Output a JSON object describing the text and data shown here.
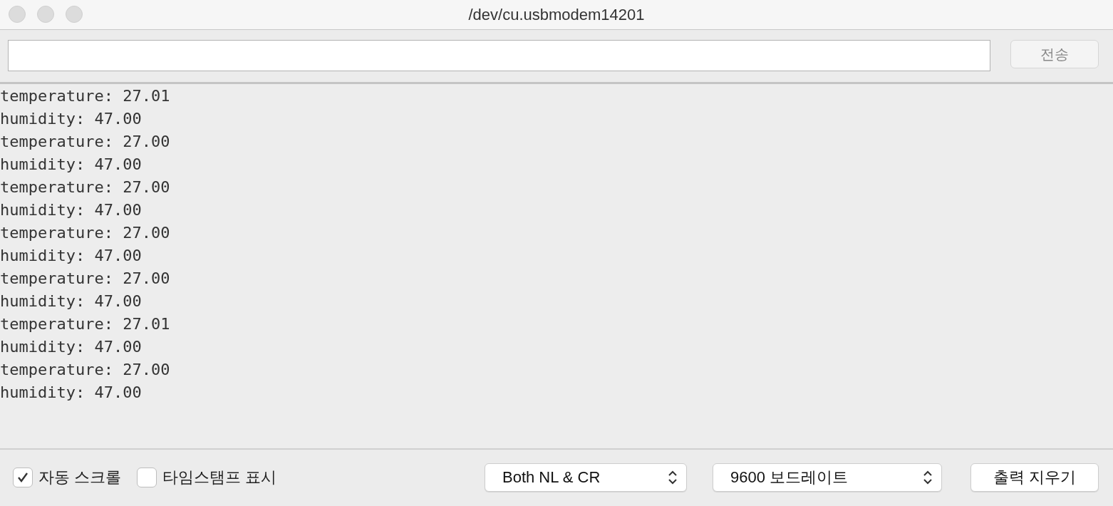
{
  "window": {
    "title": "/dev/cu.usbmodem14201"
  },
  "send_button": {
    "label": "전송",
    "disabled": true
  },
  "output_lines": [
    "temperature: 27.01",
    "humidity: 47.00",
    "temperature: 27.00",
    "humidity: 47.00",
    "temperature: 27.00",
    "humidity: 47.00",
    "temperature: 27.00",
    "humidity: 47.00",
    "temperature: 27.00",
    "humidity: 47.00",
    "temperature: 27.01",
    "humidity: 47.00",
    "temperature: 27.00",
    "humidity: 47.00"
  ],
  "options": [
    {
      "label": "자동 스크롤",
      "checked": true
    },
    {
      "label": "타임스탬프 표시",
      "checked": false
    }
  ],
  "line_ending": {
    "value": "Both NL & CR"
  },
  "baud_rate": {
    "value": "9600 보드레이트"
  },
  "clear_button": {
    "label": "출력 지우기"
  }
}
